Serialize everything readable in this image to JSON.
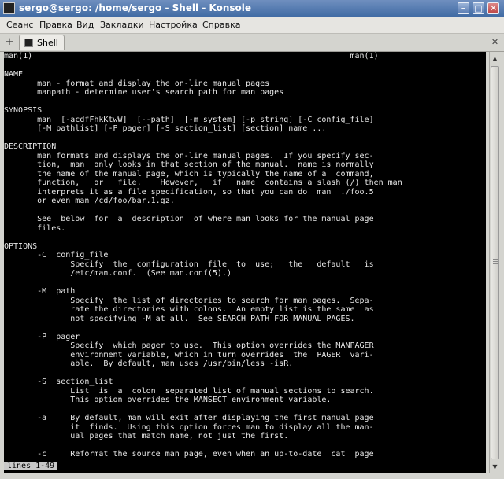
{
  "window": {
    "title": "sergo@sergo: /home/sergo - Shell - Konsole",
    "minimize": "–",
    "maximize": "□",
    "close": "✕"
  },
  "menu": [
    "Сеанс",
    "Правка",
    "Вид",
    "Закладки",
    "Настройка",
    "Справка"
  ],
  "tab": {
    "label": "Shell",
    "new_tab": "+",
    "close": "✕"
  },
  "terminal": {
    "status": "lines 1-49",
    "lines": [
      "man(1)                                                                   man(1)",
      "",
      "NAME",
      "       man - format and display the on-line manual pages",
      "       manpath - determine user's search path for man pages",
      "",
      "SYNOPSIS",
      "       man  [-acdfFhkKtwW]  [--path]  [-m system] [-p string] [-C config_file]",
      "       [-M pathlist] [-P pager] [-S section_list] [section] name ...",
      "",
      "DESCRIPTION",
      "       man formats and displays the on-line manual pages.  If you specify sec-",
      "       tion,  man  only looks in that section of the manual.  name is normally",
      "       the name of the manual page, which is typically the name of a  command,",
      "       function,   or   file.    However,   if   name  contains a slash (/) then man",
      "       interprets it as a file specification, so that you can do  man  ./foo.5",
      "       or even man /cd/foo/bar.1.gz.",
      "",
      "       See  below  for  a  description  of where man looks for the manual page",
      "       files.",
      "",
      "OPTIONS",
      "       -C  config_file",
      "              Specify  the  configuration  file  to  use;   the   default   is",
      "              /etc/man.conf.  (See man.conf(5).)",
      "",
      "       -M  path",
      "              Specify  the list of directories to search for man pages.  Sepa-",
      "              rate the directories with colons.  An empty list is the same  as",
      "              not specifying -M at all.  See SEARCH PATH FOR MANUAL PAGES.",
      "",
      "       -P  pager",
      "              Specify  which pager to use.  This option overrides the MANPAGER",
      "              environment variable, which in turn overrides  the  PAGER  vari-",
      "              able.  By default, man uses /usr/bin/less -isR.",
      "",
      "       -S  section_list",
      "              List  is  a  colon  separated list of manual sections to search.",
      "              This option overrides the MANSECT environment variable.",
      "",
      "       -a     By default, man will exit after displaying the first manual page",
      "              it  finds.  Using this option forces man to display all the man-",
      "              ual pages that match name, not just the first.",
      "",
      "       -c     Reformat the source man page, even when an up-to-date  cat  page"
    ]
  }
}
